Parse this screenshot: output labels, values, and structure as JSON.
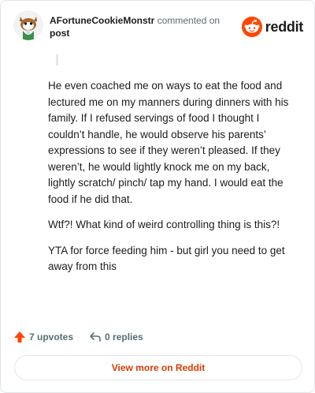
{
  "comment": {
    "author": "AFortuneCookieMonstr",
    "action_text": "commented on",
    "post_link": "post",
    "paragraphs": [
      "He even coached me on ways to eat the food and lectured me on my manners during dinners with his family. If I refused servings of food I thought I couldn’t handle, he would observe his parents’ expressions to see if they weren’t pleased. If they weren’t, he would lightly knock me on my back, lightly scratch/ pinch/ tap my hand. I would eat the food if he did that.",
      "Wtf?! What kind of weird controlling thing is this?!",
      "YTA for force feeding him - but girl you need to get away from this"
    ]
  },
  "brand": {
    "name": "reddit",
    "icon": "reddit-logo-icon",
    "color": "#ff4500"
  },
  "actions": {
    "upvotes": "7 upvotes",
    "replies": "0 replies",
    "upvote_icon": "upvote-arrow-icon",
    "reply_icon": "reply-arrow-icon",
    "upvote_color": "#ff4500"
  },
  "footer": {
    "view_more": "View more on Reddit",
    "color": "#d93a00"
  }
}
